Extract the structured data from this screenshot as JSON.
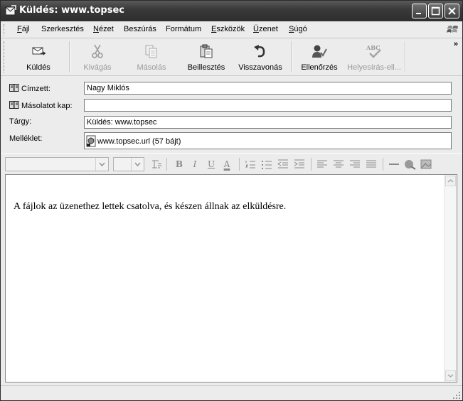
{
  "window": {
    "title": "Küldés: www.topsec"
  },
  "menu": [
    {
      "label": "Fájl",
      "key": "F",
      "rest": "ájl"
    },
    {
      "label": "Szerkesztés",
      "key": "",
      "rest": "Szerkesztés"
    },
    {
      "label": "Nézet",
      "key": "N",
      "rest": "ézet"
    },
    {
      "label": "Beszúrás",
      "key": "",
      "rest": "Beszúrás"
    },
    {
      "label": "Formátum",
      "key": "",
      "rest": "Formátum"
    },
    {
      "label": "Eszközök",
      "key": "E",
      "rest": "szközök"
    },
    {
      "label": "Üzenet",
      "key": "Ü",
      "rest": "zenet"
    },
    {
      "label": "Súgó",
      "key": "S",
      "rest": "úgó"
    }
  ],
  "toolbar": {
    "send": "Küldés",
    "cut": "Kivágás",
    "copy": "Másolás",
    "paste": "Beillesztés",
    "undo": "Visszavonás",
    "check": "Ellenőrzés",
    "spelling": "Helyesírás-ell...",
    "more": "»"
  },
  "header": {
    "to_label": "Címzett:",
    "to_value": "Nagy Miklós",
    "cc_label": "Másolatot kap:",
    "cc_value": "",
    "subject_label": "Tárgy:",
    "subject_value": "Küldés: www.topsec",
    "attach_label": "Melléklet:",
    "attach_value": "www.topsec.url (57 bájt)"
  },
  "format": {
    "bold": "B",
    "italic": "I",
    "underline": "U",
    "fontcolor": "A"
  },
  "message": {
    "body": "A fájlok az üzenethez lettek csatolva, és készen állnak az elküldésre."
  }
}
